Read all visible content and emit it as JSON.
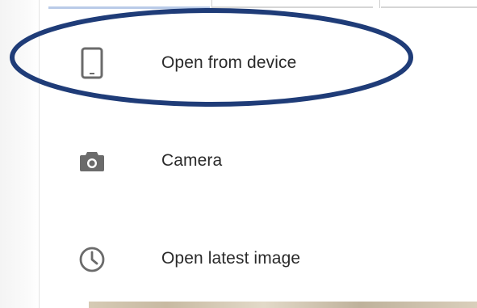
{
  "menu": {
    "items": [
      {
        "label": "Open from device",
        "icon": "tablet-icon"
      },
      {
        "label": "Camera",
        "icon": "camera-icon"
      },
      {
        "label": "Open latest image",
        "icon": "clock-icon"
      }
    ]
  },
  "colors": {
    "highlight": "#1f3c78",
    "icon": "#6b6b6b",
    "text": "#2a2a2a"
  }
}
